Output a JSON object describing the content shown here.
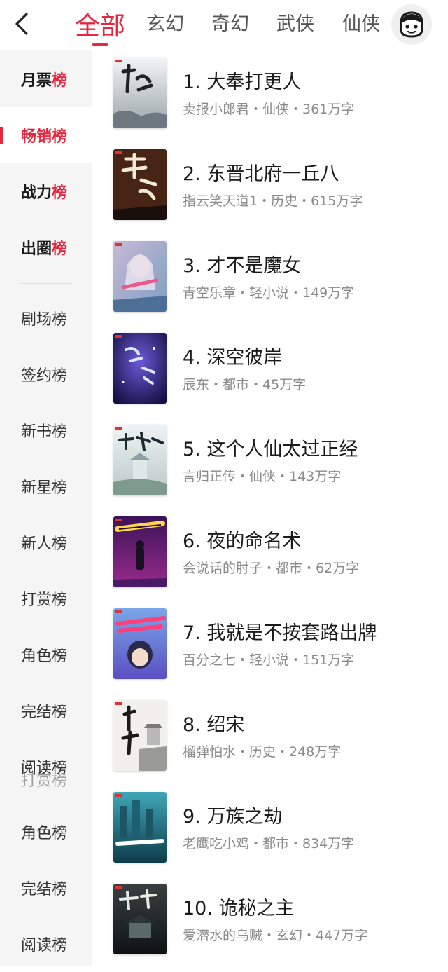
{
  "header": {
    "back_icon": "chevron-left-icon",
    "tabs": [
      {
        "label": "全部",
        "active": true
      },
      {
        "label": "玄幻",
        "active": false
      },
      {
        "label": "奇幻",
        "active": false
      },
      {
        "label": "武侠",
        "active": false
      },
      {
        "label": "仙侠",
        "active": false
      }
    ],
    "avatar_icon": "user-avatar-icon"
  },
  "accent_color": "#e5283f",
  "sidebar": {
    "items": [
      {
        "prefix": "月票",
        "suffix": "榜"
      },
      {
        "prefix": "畅销",
        "suffix": "榜"
      },
      {
        "prefix": "战力",
        "suffix": "榜"
      },
      {
        "prefix": "出圈",
        "suffix": "榜"
      },
      {
        "label": "剧场榜"
      },
      {
        "label": "签约榜"
      },
      {
        "label": "新书榜"
      },
      {
        "label": "新星榜"
      },
      {
        "label": "新人榜"
      },
      {
        "label": "打赏榜"
      },
      {
        "label": "角色榜"
      },
      {
        "label": "完结榜"
      },
      {
        "label": "阅读榜"
      },
      {
        "label": "角色榜"
      },
      {
        "label": "完结榜"
      },
      {
        "label": "阅读榜"
      }
    ],
    "ghost_label": "打赏榜"
  },
  "books": [
    {
      "title": "1. 大奉打更人",
      "meta": "卖报小郎君・仙侠・361万字"
    },
    {
      "title": "2. 东晋北府一丘八",
      "meta": "指云笑天道1・历史・615万字"
    },
    {
      "title": "3. 才不是魔女",
      "meta": "青空乐章・轻小说・149万字"
    },
    {
      "title": "4. 深空彼岸",
      "meta": "辰东・都市・45万字"
    },
    {
      "title": "5. 这个人仙太过正经",
      "meta": "言归正传・仙侠・143万字"
    },
    {
      "title": "6. 夜的命名术",
      "meta": "会说话的肘子・都市・62万字"
    },
    {
      "title": "7. 我就是不按套路出牌",
      "meta": "百分之七・轻小说・151万字"
    },
    {
      "title": "8. 绍宋",
      "meta": "榴弹怕水・历史・248万字"
    },
    {
      "title": "9. 万族之劫",
      "meta": "老鹰吃小鸡・都市・834万字"
    },
    {
      "title": "10. 诡秘之主",
      "meta": "爱潜水的乌贼・玄幻・447万字"
    }
  ]
}
